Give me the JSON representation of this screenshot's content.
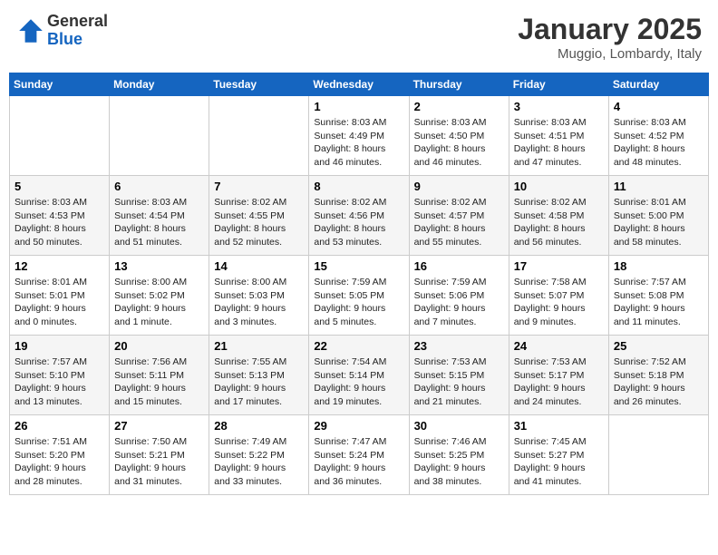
{
  "header": {
    "logo_general": "General",
    "logo_blue": "Blue",
    "month_title": "January 2025",
    "location": "Muggio, Lombardy, Italy"
  },
  "weekdays": [
    "Sunday",
    "Monday",
    "Tuesday",
    "Wednesday",
    "Thursday",
    "Friday",
    "Saturday"
  ],
  "weeks": [
    [
      {
        "day": "",
        "info": ""
      },
      {
        "day": "",
        "info": ""
      },
      {
        "day": "",
        "info": ""
      },
      {
        "day": "1",
        "info": "Sunrise: 8:03 AM\nSunset: 4:49 PM\nDaylight: 8 hours and 46 minutes."
      },
      {
        "day": "2",
        "info": "Sunrise: 8:03 AM\nSunset: 4:50 PM\nDaylight: 8 hours and 46 minutes."
      },
      {
        "day": "3",
        "info": "Sunrise: 8:03 AM\nSunset: 4:51 PM\nDaylight: 8 hours and 47 minutes."
      },
      {
        "day": "4",
        "info": "Sunrise: 8:03 AM\nSunset: 4:52 PM\nDaylight: 8 hours and 48 minutes."
      }
    ],
    [
      {
        "day": "5",
        "info": "Sunrise: 8:03 AM\nSunset: 4:53 PM\nDaylight: 8 hours and 50 minutes."
      },
      {
        "day": "6",
        "info": "Sunrise: 8:03 AM\nSunset: 4:54 PM\nDaylight: 8 hours and 51 minutes."
      },
      {
        "day": "7",
        "info": "Sunrise: 8:02 AM\nSunset: 4:55 PM\nDaylight: 8 hours and 52 minutes."
      },
      {
        "day": "8",
        "info": "Sunrise: 8:02 AM\nSunset: 4:56 PM\nDaylight: 8 hours and 53 minutes."
      },
      {
        "day": "9",
        "info": "Sunrise: 8:02 AM\nSunset: 4:57 PM\nDaylight: 8 hours and 55 minutes."
      },
      {
        "day": "10",
        "info": "Sunrise: 8:02 AM\nSunset: 4:58 PM\nDaylight: 8 hours and 56 minutes."
      },
      {
        "day": "11",
        "info": "Sunrise: 8:01 AM\nSunset: 5:00 PM\nDaylight: 8 hours and 58 minutes."
      }
    ],
    [
      {
        "day": "12",
        "info": "Sunrise: 8:01 AM\nSunset: 5:01 PM\nDaylight: 9 hours and 0 minutes."
      },
      {
        "day": "13",
        "info": "Sunrise: 8:00 AM\nSunset: 5:02 PM\nDaylight: 9 hours and 1 minute."
      },
      {
        "day": "14",
        "info": "Sunrise: 8:00 AM\nSunset: 5:03 PM\nDaylight: 9 hours and 3 minutes."
      },
      {
        "day": "15",
        "info": "Sunrise: 7:59 AM\nSunset: 5:05 PM\nDaylight: 9 hours and 5 minutes."
      },
      {
        "day": "16",
        "info": "Sunrise: 7:59 AM\nSunset: 5:06 PM\nDaylight: 9 hours and 7 minutes."
      },
      {
        "day": "17",
        "info": "Sunrise: 7:58 AM\nSunset: 5:07 PM\nDaylight: 9 hours and 9 minutes."
      },
      {
        "day": "18",
        "info": "Sunrise: 7:57 AM\nSunset: 5:08 PM\nDaylight: 9 hours and 11 minutes."
      }
    ],
    [
      {
        "day": "19",
        "info": "Sunrise: 7:57 AM\nSunset: 5:10 PM\nDaylight: 9 hours and 13 minutes."
      },
      {
        "day": "20",
        "info": "Sunrise: 7:56 AM\nSunset: 5:11 PM\nDaylight: 9 hours and 15 minutes."
      },
      {
        "day": "21",
        "info": "Sunrise: 7:55 AM\nSunset: 5:13 PM\nDaylight: 9 hours and 17 minutes."
      },
      {
        "day": "22",
        "info": "Sunrise: 7:54 AM\nSunset: 5:14 PM\nDaylight: 9 hours and 19 minutes."
      },
      {
        "day": "23",
        "info": "Sunrise: 7:53 AM\nSunset: 5:15 PM\nDaylight: 9 hours and 21 minutes."
      },
      {
        "day": "24",
        "info": "Sunrise: 7:53 AM\nSunset: 5:17 PM\nDaylight: 9 hours and 24 minutes."
      },
      {
        "day": "25",
        "info": "Sunrise: 7:52 AM\nSunset: 5:18 PM\nDaylight: 9 hours and 26 minutes."
      }
    ],
    [
      {
        "day": "26",
        "info": "Sunrise: 7:51 AM\nSunset: 5:20 PM\nDaylight: 9 hours and 28 minutes."
      },
      {
        "day": "27",
        "info": "Sunrise: 7:50 AM\nSunset: 5:21 PM\nDaylight: 9 hours and 31 minutes."
      },
      {
        "day": "28",
        "info": "Sunrise: 7:49 AM\nSunset: 5:22 PM\nDaylight: 9 hours and 33 minutes."
      },
      {
        "day": "29",
        "info": "Sunrise: 7:47 AM\nSunset: 5:24 PM\nDaylight: 9 hours and 36 minutes."
      },
      {
        "day": "30",
        "info": "Sunrise: 7:46 AM\nSunset: 5:25 PM\nDaylight: 9 hours and 38 minutes."
      },
      {
        "day": "31",
        "info": "Sunrise: 7:45 AM\nSunset: 5:27 PM\nDaylight: 9 hours and 41 minutes."
      },
      {
        "day": "",
        "info": ""
      }
    ]
  ]
}
